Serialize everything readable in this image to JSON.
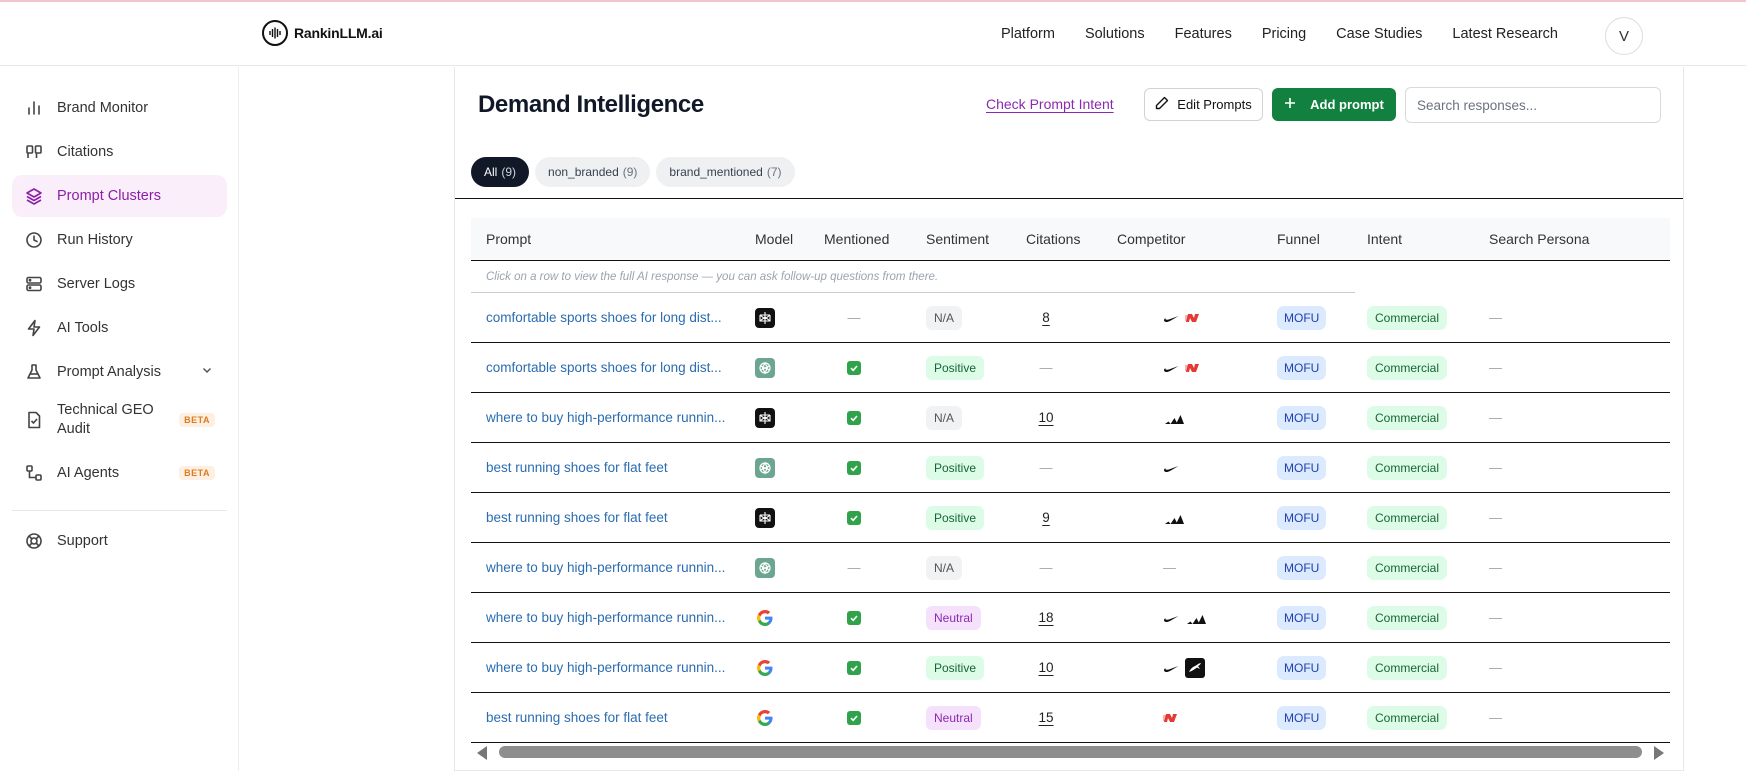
{
  "brand": {
    "name": "RankinLLM.ai"
  },
  "nav": {
    "links": [
      "Platform",
      "Solutions",
      "Features",
      "Pricing",
      "Case Studies",
      "Latest Research"
    ],
    "avatar_initial": "V"
  },
  "sidebar": {
    "items": [
      {
        "label": "Brand Monitor",
        "icon": "bar-chart-icon"
      },
      {
        "label": "Citations",
        "icon": "quote-icon"
      },
      {
        "label": "Prompt Clusters",
        "icon": "layers-icon",
        "active": true
      },
      {
        "label": "Run History",
        "icon": "clock-icon"
      },
      {
        "label": "Server Logs",
        "icon": "server-icon"
      },
      {
        "label": "AI Tools",
        "icon": "lightning-icon"
      },
      {
        "label": "Prompt Analysis",
        "icon": "flask-icon"
      },
      {
        "label": "Technical GEO Audit",
        "icon": "file-check-icon",
        "badge": "BETA"
      },
      {
        "label": "AI Agents",
        "icon": "workflow-icon",
        "badge": "BETA"
      },
      {
        "label": "Support",
        "icon": "lifebuoy-icon"
      }
    ]
  },
  "main": {
    "title": "Demand Intelligence",
    "check_intent_label": "Check Prompt Intent",
    "edit_prompts_label": "Edit Prompts",
    "add_prompt_label": "Add prompt",
    "search_placeholder": "Search responses...",
    "filters": [
      {
        "label": "All",
        "count": "(9)",
        "active": true
      },
      {
        "label": "non_branded",
        "count": "(9)"
      },
      {
        "label": "brand_mentioned",
        "count": "(7)"
      }
    ],
    "columns": [
      "Prompt",
      "Model",
      "Mentioned",
      "Sentiment",
      "Citations",
      "Competitor",
      "Funnel",
      "Intent",
      "Search Persona"
    ],
    "hint": "Click on a row to view the full AI response — you can ask follow-up questions from there.",
    "rows": [
      {
        "prompt": "comfortable sports shoes for long dist...",
        "model": "perplexity",
        "mentioned": false,
        "sentiment": "N/A",
        "citations": "8",
        "competitors": [
          "nike",
          "new-balance"
        ],
        "funnel": "MOFU",
        "intent": "Commercial",
        "persona": "—"
      },
      {
        "prompt": "comfortable sports shoes for long dist...",
        "model": "chatgpt",
        "mentioned": true,
        "sentiment": "Positive",
        "citations": "—",
        "competitors": [
          "nike",
          "new-balance"
        ],
        "funnel": "MOFU",
        "intent": "Commercial",
        "persona": "—"
      },
      {
        "prompt": "where to buy high-performance runnin...",
        "model": "perplexity",
        "mentioned": true,
        "sentiment": "N/A",
        "citations": "10",
        "competitors": [
          "adidas"
        ],
        "funnel": "MOFU",
        "intent": "Commercial",
        "persona": "—"
      },
      {
        "prompt": "best running shoes for flat feet",
        "model": "chatgpt",
        "mentioned": true,
        "sentiment": "Positive",
        "citations": "—",
        "competitors": [
          "nike"
        ],
        "funnel": "MOFU",
        "intent": "Commercial",
        "persona": "—"
      },
      {
        "prompt": "best running shoes for flat feet",
        "model": "perplexity",
        "mentioned": true,
        "sentiment": "Positive",
        "citations": "9",
        "competitors": [
          "adidas"
        ],
        "funnel": "MOFU",
        "intent": "Commercial",
        "persona": "—"
      },
      {
        "prompt": "where to buy high-performance runnin...",
        "model": "chatgpt",
        "mentioned": false,
        "sentiment": "N/A",
        "citations": "—",
        "competitors": [],
        "funnel": "MOFU",
        "intent": "Commercial",
        "persona": "—"
      },
      {
        "prompt": "where to buy high-performance runnin...",
        "model": "google",
        "mentioned": true,
        "sentiment": "Neutral",
        "citations": "18",
        "competitors": [
          "nike",
          "adidas"
        ],
        "funnel": "MOFU",
        "intent": "Commercial",
        "persona": "—"
      },
      {
        "prompt": "where to buy high-performance runnin...",
        "model": "google",
        "mentioned": true,
        "sentiment": "Positive",
        "citations": "10",
        "competitors": [
          "nike",
          "puma"
        ],
        "funnel": "MOFU",
        "intent": "Commercial",
        "persona": "—"
      },
      {
        "prompt": "best running shoes for flat feet",
        "model": "google",
        "mentioned": true,
        "sentiment": "Neutral",
        "citations": "15",
        "competitors": [
          "new-balance"
        ],
        "funnel": "MOFU",
        "intent": "Commercial",
        "persona": "—"
      }
    ],
    "empty_mark": "—"
  },
  "colors": {
    "accent": "#8b1fa8",
    "primary_button": "#12803f",
    "link": "#2b6cb0"
  }
}
